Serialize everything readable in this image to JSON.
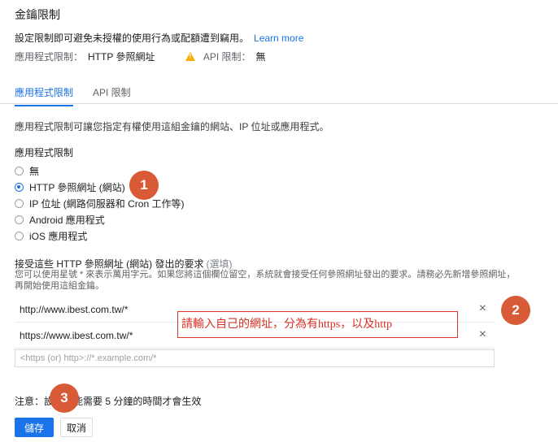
{
  "header": {
    "title": "金鑰限制",
    "description": "設定限制即可避免未授權的使用行為或配額遭到竊用。",
    "learn_more": "Learn more",
    "app_restriction_label": "應用程式限制：",
    "app_restriction_value": "HTTP 參照網址",
    "api_restriction_label": "API 限制：",
    "api_restriction_value": "無"
  },
  "tabs": [
    {
      "label": "應用程式限制",
      "active": true
    },
    {
      "label": "API 限制",
      "active": false
    }
  ],
  "intro": "應用程式限制可讓您指定有權使用這組金鑰的網站、IP 位址或應用程式。",
  "section_title": "應用程式限制",
  "radio_options": [
    {
      "label": "無",
      "selected": false
    },
    {
      "label": "HTTP 參照網址 (網站)",
      "selected": true
    },
    {
      "label": "IP 位址 (網路伺服器和 Cron 工作等)",
      "selected": false
    },
    {
      "label": "Android 應用程式",
      "selected": false
    },
    {
      "label": "iOS 應用程式",
      "selected": false
    }
  ],
  "referrers": {
    "title": "接受這些 HTTP 參照網址 (網站) 發出的要求",
    "optional": "(選填)",
    "help": "您可以使用星號 * 來表示萬用字元。如果您將這個欄位留空，系統就會接受任何參照網址發出的要求。請務必先新增參照網址，再開始使用這組金鑰。",
    "items": [
      "http://www.ibest.com.tw/*",
      "https://www.ibest.com.tw/*"
    ],
    "remove_symbol": "×",
    "placeholder": "<https (or) http>://*.example.com/*"
  },
  "annotation": "請輸入自己的網址，分為有https，以及http",
  "badges": [
    "1",
    "2",
    "3"
  ],
  "note": "注意：設定可能需要 5 分鐘的時間才會生效",
  "buttons": {
    "save": "儲存",
    "cancel": "取消"
  },
  "colors": {
    "accent": "#1a73e8",
    "badge": "#d95a36",
    "annotation": "#d93025",
    "warning": "#f9ab00"
  }
}
